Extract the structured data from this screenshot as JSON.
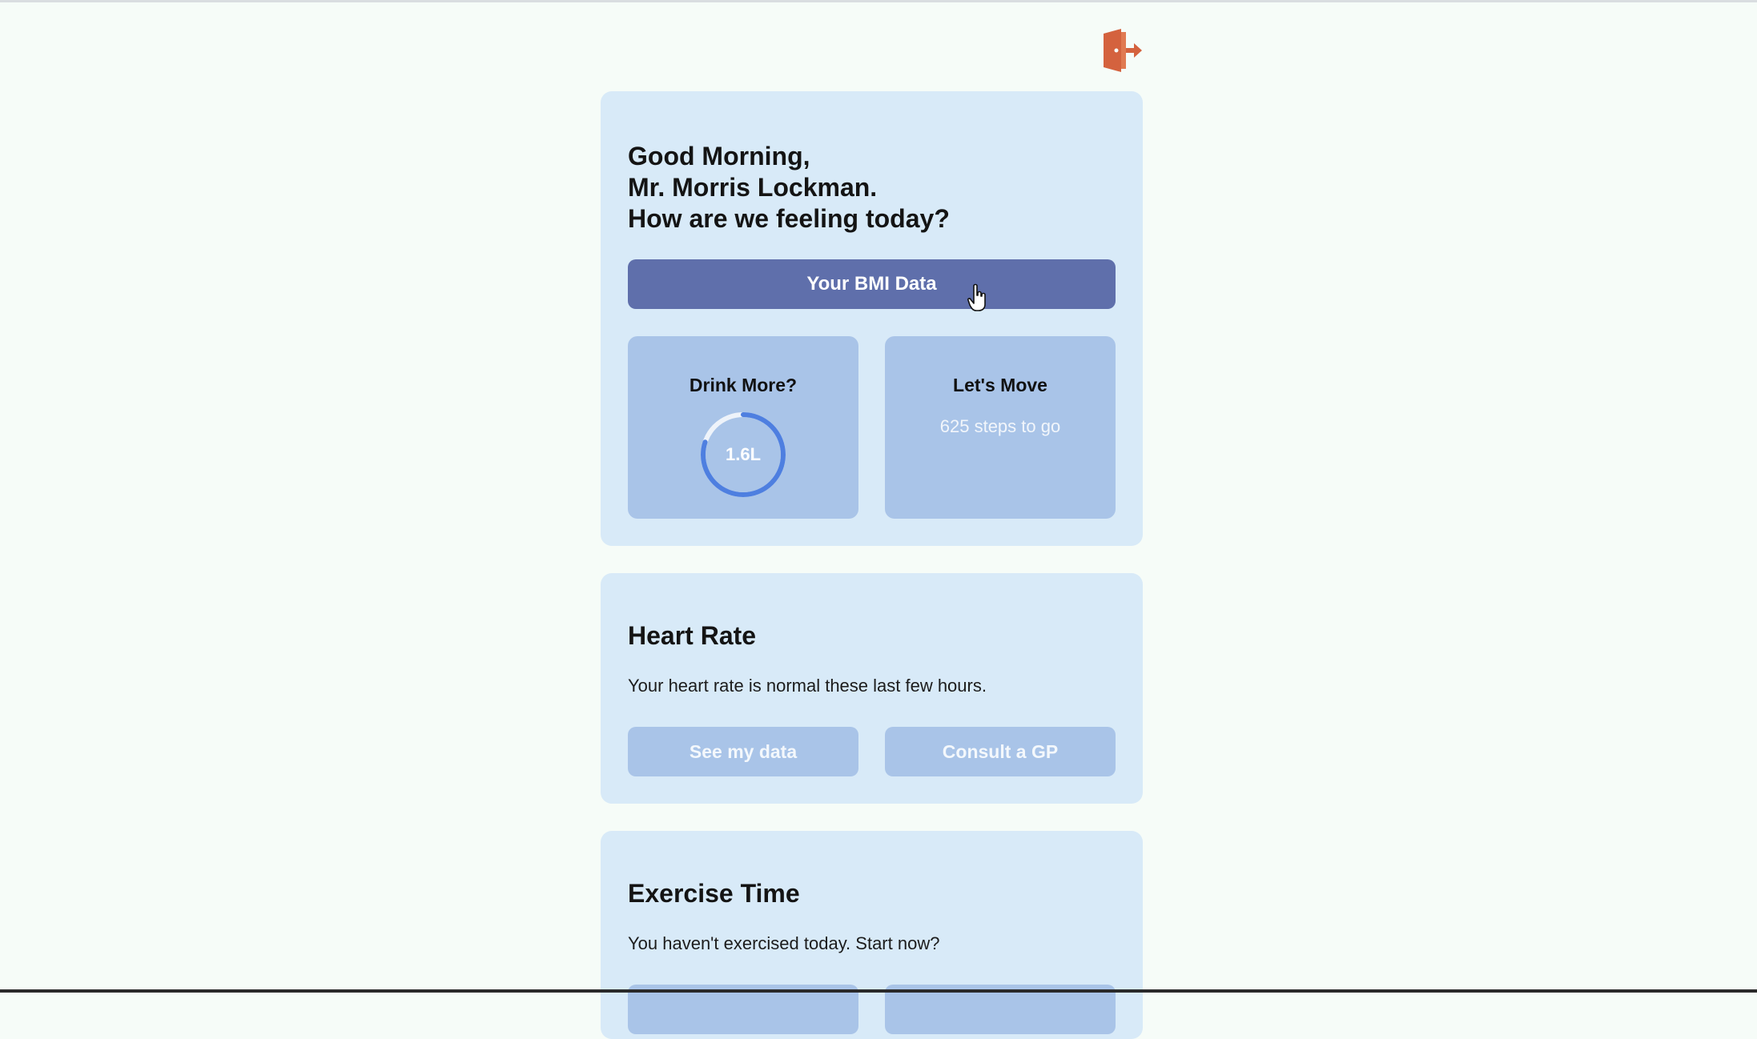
{
  "greeting": {
    "line1": "Good Morning,",
    "line2": "Mr. Morris Lockman.",
    "line3": "How are we feeling today?"
  },
  "bmi_button": {
    "label": "Your BMI Data"
  },
  "drink_tile": {
    "title": "Drink More?",
    "value": "1.6L",
    "progress": 0.8
  },
  "move_tile": {
    "title": "Let's Move",
    "subtitle": "625 steps to go"
  },
  "heart_rate": {
    "title": "Heart Rate",
    "text": "Your heart rate is normal these last few hours.",
    "see_data_label": "See my data",
    "consult_label": "Consult a GP"
  },
  "exercise": {
    "title": "Exercise Time",
    "text": "You haven't exercised today. Start now?"
  },
  "icons": {
    "logout": "logout-door-icon",
    "cursor": "hand-pointer-icon"
  },
  "colors": {
    "background": "#f6fcf8",
    "card": "#d8eaf8",
    "tile": "#a9c4e8",
    "primary_button": "#5f6fab",
    "ring_progress": "#4e7fe0",
    "logout_icon": "#d4623e"
  }
}
